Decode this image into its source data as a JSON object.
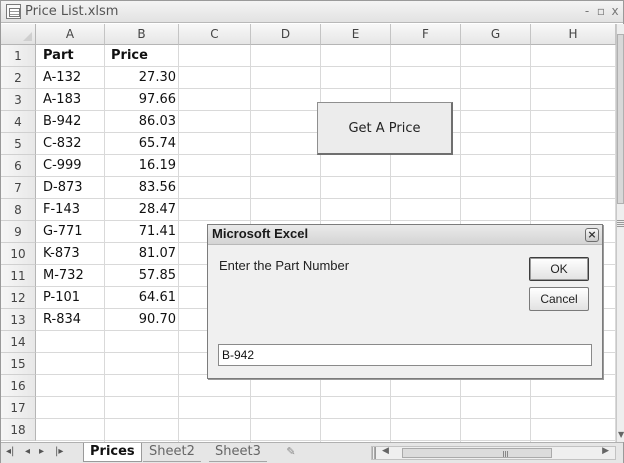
{
  "window": {
    "title": "Price List.xlsm",
    "minimize": "-",
    "restore": "▫",
    "close": "x"
  },
  "columns": [
    "A",
    "B",
    "C",
    "D",
    "E",
    "F",
    "G",
    "H"
  ],
  "rows": [
    "1",
    "2",
    "3",
    "4",
    "5",
    "6",
    "7",
    "8",
    "9",
    "10",
    "11",
    "12",
    "13",
    "14",
    "15",
    "16",
    "17",
    "18"
  ],
  "table": {
    "headers": [
      "Part",
      "Price"
    ],
    "data": [
      [
        "A-132",
        "27.30"
      ],
      [
        "A-183",
        "97.66"
      ],
      [
        "B-942",
        "86.03"
      ],
      [
        "C-832",
        "65.74"
      ],
      [
        "C-999",
        "16.19"
      ],
      [
        "D-873",
        "83.56"
      ],
      [
        "F-143",
        "28.47"
      ],
      [
        "G-771",
        "71.41"
      ],
      [
        "K-873",
        "81.07"
      ],
      [
        "M-732",
        "57.85"
      ],
      [
        "P-101",
        "64.61"
      ],
      [
        "R-834",
        "90.70"
      ]
    ]
  },
  "shape_button": {
    "label": "Get A Price"
  },
  "dialog": {
    "title": "Microsoft Excel",
    "prompt": "Enter the Part Number",
    "ok_label": "OK",
    "cancel_label": "Cancel",
    "input_value": "B-942",
    "close_glyph": "×"
  },
  "sheets": {
    "tabs": [
      "Prices",
      "Sheet2",
      "Sheet3"
    ],
    "active": "Prices",
    "new_sheet_glyph": "✎"
  },
  "nav": {
    "first": "◂|",
    "prev": "◂",
    "next": "▸",
    "last": "|▸"
  },
  "icons": {
    "app": "excel-workbook-icon",
    "close": "close-icon"
  }
}
